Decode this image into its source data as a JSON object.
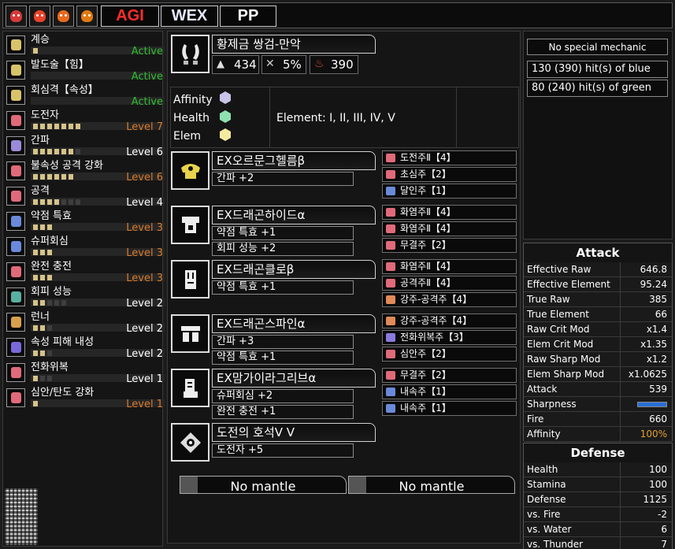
{
  "topbar": {
    "hunter_icons": [
      {
        "name": "monster-icon-1",
        "color": "#d63a3a"
      },
      {
        "name": "monster-icon-2",
        "color": "#e8432c"
      },
      {
        "name": "monster-icon-3",
        "color": "#e66a1e"
      },
      {
        "name": "monster-icon-4",
        "color": "#e07a12"
      }
    ],
    "sets": [
      "AGI",
      "WEX",
      "PP"
    ],
    "set_colors": [
      "#ff2d2d",
      "#e6e6ff",
      "#ffffff"
    ]
  },
  "skills": [
    {
      "name": "계승",
      "level": "Active",
      "level_color": "#2fbf2f",
      "pips_on": 1,
      "pips_total": 1,
      "gem": "#d9c36a"
    },
    {
      "name": "발도술【힘】",
      "level": "Active",
      "level_color": "#2fbf2f",
      "pips_on": 0,
      "pips_total": 0,
      "gem": "#d9c36a"
    },
    {
      "name": "회심격【속성】",
      "level": "Active",
      "level_color": "#2fbf2f",
      "pips_on": 0,
      "pips_total": 0,
      "gem": "#d9c36a"
    },
    {
      "name": "도전자",
      "level": "Level 7",
      "level_color": "#d97b2a",
      "pips_on": 7,
      "pips_total": 7,
      "gem": "#e06a7a"
    },
    {
      "name": "간파",
      "level": "Level 6",
      "level_color": "#ffffff",
      "pips_on": 6,
      "pips_total": 7,
      "gem": "#9a8ad9"
    },
    {
      "name": "불속성 공격 강화",
      "level": "Level 6",
      "level_color": "#d97b2a",
      "pips_on": 6,
      "pips_total": 6,
      "gem": "#e06a7a"
    },
    {
      "name": "공격",
      "level": "Level 4",
      "level_color": "#ffffff",
      "pips_on": 4,
      "pips_total": 7,
      "gem": "#e06a7a"
    },
    {
      "name": "약점 특효",
      "level": "Level 3",
      "level_color": "#d97b2a",
      "pips_on": 3,
      "pips_total": 3,
      "gem": "#6a8ad9"
    },
    {
      "name": "슈퍼회심",
      "level": "Level 3",
      "level_color": "#d97b2a",
      "pips_on": 3,
      "pips_total": 3,
      "gem": "#6a8ad9"
    },
    {
      "name": "완전 충전",
      "level": "Level 3",
      "level_color": "#d97b2a",
      "pips_on": 3,
      "pips_total": 3,
      "gem": "#e06a7a"
    },
    {
      "name": "회피 성능",
      "level": "Level 2",
      "level_color": "#ffffff",
      "pips_on": 2,
      "pips_total": 5,
      "gem": "#5ab0a0"
    },
    {
      "name": "런너",
      "level": "Level 2",
      "level_color": "#ffffff",
      "pips_on": 2,
      "pips_total": 3,
      "gem": "#d9a04a"
    },
    {
      "name": "속성 피해 내성",
      "level": "Level 2",
      "level_color": "#ffffff",
      "pips_on": 2,
      "pips_total": 3,
      "gem": "#7a6ad9"
    },
    {
      "name": "전화위복",
      "level": "Level 1",
      "level_color": "#ffffff",
      "pips_on": 1,
      "pips_total": 3,
      "gem": "#e06a7a"
    },
    {
      "name": "심안/탄도 강화",
      "level": "Level 1",
      "level_color": "#d97b2a",
      "pips_on": 1,
      "pips_total": 1,
      "gem": "#e06a7a"
    }
  ],
  "weapon": {
    "name": "황제금 쌍검-만악",
    "attack": "434",
    "affinity": "5%",
    "element": "390",
    "affinity_label": "Affinity",
    "health_label": "Health",
    "elem_label": "Elem",
    "element_rampage": "Element: I, II, III, IV, V"
  },
  "armor": [
    {
      "name": "EX오르문그헬름β",
      "skills": [
        "간파 +2"
      ],
      "decos": [
        {
          "name": "도전주Ⅱ【4】",
          "color": "#e06a7a"
        },
        {
          "name": "초심주【2】",
          "color": "#e06a7a"
        },
        {
          "name": "달인주【1】",
          "color": "#6a8ad9"
        }
      ]
    },
    {
      "name": "EX드래곤하이드α",
      "skills": [
        "약점 특효 +1",
        "회피 성능 +2"
      ],
      "decos": [
        {
          "name": "화염주Ⅱ【4】",
          "color": "#e06a7a"
        },
        {
          "name": "화염주Ⅱ【4】",
          "color": "#e06a7a"
        },
        {
          "name": "무결주【2】",
          "color": "#e06a7a"
        }
      ]
    },
    {
      "name": "EX드래곤클로β",
      "skills": [
        "약점 특효 +1"
      ],
      "decos": [
        {
          "name": "화염주Ⅱ【4】",
          "color": "#e06a7a"
        },
        {
          "name": "공격주Ⅱ【4】",
          "color": "#e06a7a"
        },
        {
          "name": "강주-공격주【4】",
          "color": "#e08a5a"
        }
      ]
    },
    {
      "name": "EX드래곤스파인α",
      "skills": [
        "간파 +3",
        "약점 특효 +1"
      ],
      "decos": [
        {
          "name": "강주-공격주【4】",
          "color": "#e08a5a"
        },
        {
          "name": "전화위복주【3】",
          "color": "#8a7ae0"
        },
        {
          "name": "심안주【2】",
          "color": "#e06a7a"
        }
      ]
    },
    {
      "name": "EX맘가이라그리브α",
      "skills": [
        "슈퍼회심 +2",
        "완전 충전 +1"
      ],
      "decos": [
        {
          "name": "무결주【2】",
          "color": "#e06a7a"
        },
        {
          "name": "내속주【1】",
          "color": "#6a8ad9"
        },
        {
          "name": "내속주【1】",
          "color": "#6a8ad9"
        }
      ]
    },
    {
      "name": "도전의 호석Ⅴ Ⅴ",
      "skills": [
        "도전자 +5"
      ],
      "decos": []
    }
  ],
  "mantles": [
    "No mantle",
    "No mantle"
  ],
  "right": {
    "mechanic": "No special mechanic",
    "hits_blue": "130 (390) hit(s) of blue",
    "hits_green": "80 (240) hit(s) of green"
  },
  "attack": {
    "title": "Attack",
    "rows": [
      {
        "label": "Effective Raw",
        "value": "646.8",
        "value_color": "#ffffff"
      },
      {
        "label": "Effective Element",
        "value": "95.24",
        "value_color": "#ffffff"
      },
      {
        "label": "True Raw",
        "value": "385",
        "value_color": "#ffffff"
      },
      {
        "label": "True Element",
        "value": "66",
        "value_color": "#ffffff"
      },
      {
        "label": "Raw Crit Mod",
        "value": "x1.4",
        "value_color": "#ffffff"
      },
      {
        "label": "Elem Crit Mod",
        "value": "x1.35",
        "value_color": "#ffffff"
      },
      {
        "label": "Raw Sharp Mod",
        "value": "x1.2",
        "value_color": "#ffffff"
      },
      {
        "label": "Elem Sharp Mod",
        "value": "x1.0625",
        "value_color": "#ffffff"
      },
      {
        "label": "Attack",
        "value": "539",
        "value_color": "#ffffff"
      },
      {
        "label": "Sharpness",
        "value": "",
        "value_color": "#ffffff"
      },
      {
        "label": "Fire",
        "value": "660",
        "value_color": "#ffffff"
      },
      {
        "label": "Affinity",
        "value": "100%",
        "value_color": "#e0a030"
      }
    ]
  },
  "defense": {
    "title": "Defense",
    "rows": [
      {
        "label": "Health",
        "value": "100"
      },
      {
        "label": "Stamina",
        "value": "100"
      },
      {
        "label": "Defense",
        "value": "1125"
      },
      {
        "label": "vs. Fire",
        "value": "-2"
      },
      {
        "label": "vs. Water",
        "value": "6"
      },
      {
        "label": "vs. Thunder",
        "value": "7"
      }
    ]
  }
}
